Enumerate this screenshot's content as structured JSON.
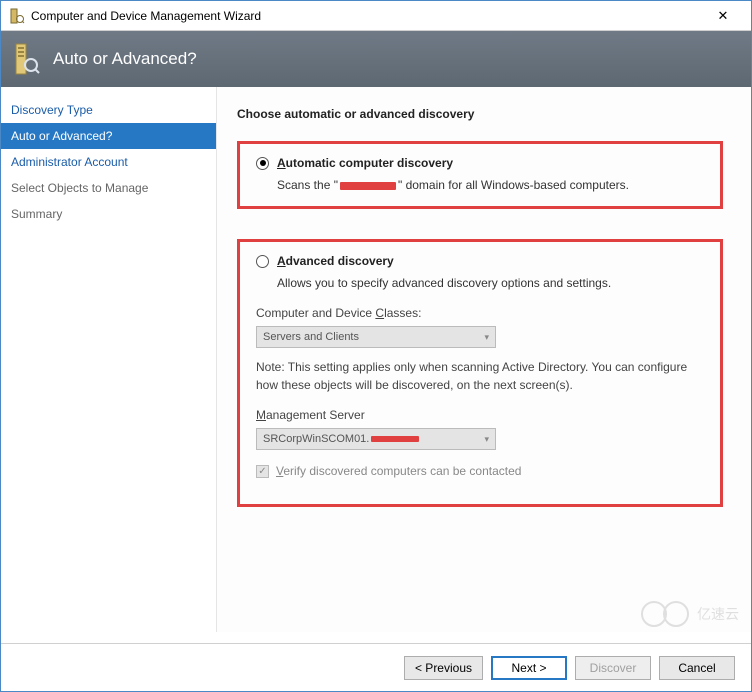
{
  "window": {
    "title": "Computer and Device Management Wizard"
  },
  "header": {
    "title": "Auto or Advanced?"
  },
  "sidebar": {
    "items": [
      {
        "label": "Discovery Type"
      },
      {
        "label": "Auto or Advanced?"
      },
      {
        "label": "Administrator Account"
      },
      {
        "label": "Select Objects to Manage"
      },
      {
        "label": "Summary"
      }
    ]
  },
  "main": {
    "section_title": "Choose automatic or advanced discovery",
    "auto": {
      "label_prefix": "A",
      "label_rest": "utomatic computer discovery",
      "desc_pre": "Scans the \"",
      "desc_post": "\" domain for all Windows-based computers."
    },
    "adv": {
      "label_prefix": "A",
      "label_rest": "dvanced discovery",
      "desc": "Allows you to specify advanced discovery options and settings.",
      "classes_label_pre": "Computer and Device ",
      "classes_label_u": "C",
      "classes_label_post": "lasses:",
      "classes_value": "Servers and Clients",
      "note": "Note: This setting applies only when scanning Active Directory.  You can configure how these objects will be discovered, on the next screen(s).",
      "mgmt_label_u": "M",
      "mgmt_label_rest": "anagement Server",
      "mgmt_value": "SRCorpWinSCOM01.",
      "verify_u": "V",
      "verify_rest": "erify discovered computers can be contacted"
    }
  },
  "footer": {
    "previous": "< Previous",
    "next": "Next >",
    "discover": "Discover",
    "cancel": "Cancel"
  },
  "watermark": "亿速云"
}
